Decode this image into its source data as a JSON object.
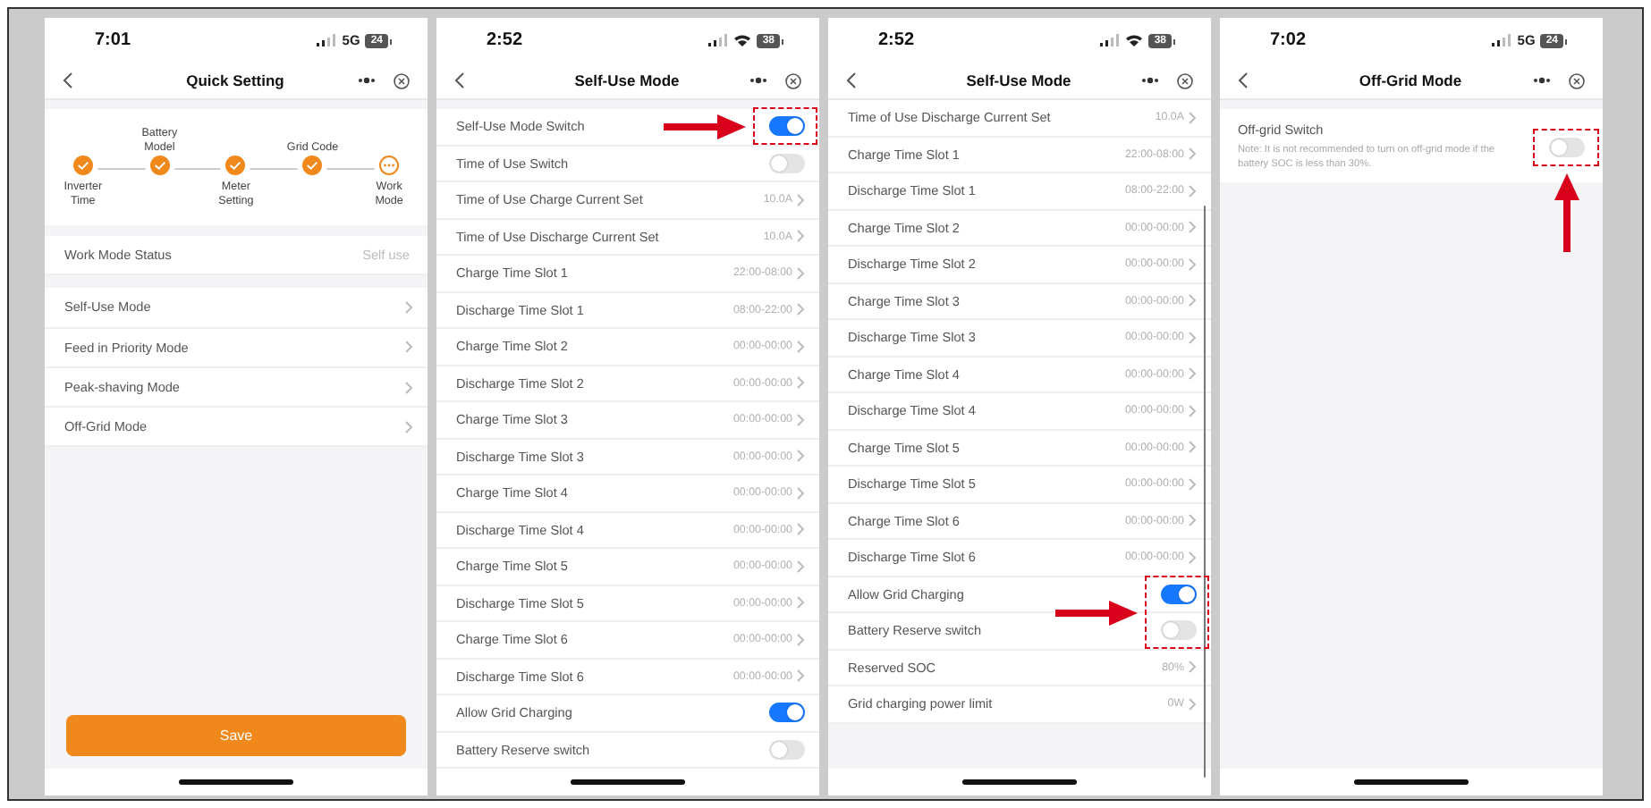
{
  "screens": [
    {
      "kind": "quick_setting",
      "scroll_indicator": false,
      "status_bar": {
        "time": "7:01",
        "network": {
          "kind": "cellular",
          "label": "5G"
        },
        "battery": "24"
      },
      "title": "Quick Setting",
      "steps": [
        {
          "label": "Inverter Time",
          "completed": true
        },
        {
          "label": "Battery Model",
          "completed": true
        },
        {
          "label": "Meter Setting",
          "completed": true
        },
        {
          "label": "Grid Code",
          "completed": true
        },
        {
          "label": "Work Mode",
          "completed": false
        }
      ],
      "groups": [
        [
          {
            "kind": "info",
            "label": "Work Mode Status",
            "value": "Self use"
          }
        ],
        [
          {
            "kind": "link",
            "label": "Self-Use Mode"
          },
          {
            "kind": "link",
            "label": "Feed in Priority Mode"
          },
          {
            "kind": "link",
            "label": "Peak-shaving Mode"
          },
          {
            "kind": "link",
            "label": "Off-Grid Mode"
          }
        ]
      ],
      "save_button": "Save"
    },
    {
      "kind": "settings",
      "scroll_indicator": false,
      "callout": {
        "kind": "left"
      },
      "status_bar": {
        "time": "2:52",
        "network": {
          "kind": "wifi"
        },
        "battery": "38"
      },
      "title": "Self-Use Mode",
      "groups": [
        [
          {
            "kind": "toggle",
            "label": "Self-Use Mode Switch",
            "on": true,
            "highlighted": true
          },
          {
            "kind": "toggle",
            "label": "Time of Use Switch",
            "on": false,
            "highlighted": false
          },
          {
            "kind": "link",
            "label": "Time of Use Charge Current Set",
            "value": "10.0A"
          },
          {
            "kind": "link",
            "label": "Time of Use Discharge Current Set",
            "value": "10.0A"
          },
          {
            "kind": "link",
            "label": "Charge Time Slot 1",
            "value": "22:00-08:00"
          },
          {
            "kind": "link",
            "label": "Discharge Time Slot 1",
            "value": "08:00-22:00"
          },
          {
            "kind": "link",
            "label": "Charge Time Slot 2",
            "value": "00:00-00:00"
          },
          {
            "kind": "link",
            "label": "Discharge Time Slot 2",
            "value": "00:00-00:00"
          },
          {
            "kind": "link",
            "label": "Charge Time Slot 3",
            "value": "00:00-00:00"
          },
          {
            "kind": "link",
            "label": "Discharge Time Slot 3",
            "value": "00:00-00:00"
          },
          {
            "kind": "link",
            "label": "Charge Time Slot 4",
            "value": "00:00-00:00"
          },
          {
            "kind": "link",
            "label": "Discharge Time Slot 4",
            "value": "00:00-00:00"
          },
          {
            "kind": "link",
            "label": "Charge Time Slot 5",
            "value": "00:00-00:00"
          },
          {
            "kind": "link",
            "label": "Discharge Time Slot 5",
            "value": "00:00-00:00"
          },
          {
            "kind": "link",
            "label": "Charge Time Slot 6",
            "value": "00:00-00:00"
          },
          {
            "kind": "link",
            "label": "Discharge Time Slot 6",
            "value": "00:00-00:00"
          },
          {
            "kind": "toggle",
            "label": "Allow Grid Charging",
            "on": true,
            "highlighted": false
          },
          {
            "kind": "toggle",
            "label": "Battery Reserve switch",
            "on": false,
            "highlighted": false
          }
        ]
      ]
    },
    {
      "kind": "settings",
      "scroll_indicator": true,
      "callout": {
        "kind": "left"
      },
      "status_bar": {
        "time": "2:52",
        "network": {
          "kind": "wifi"
        },
        "battery": "38"
      },
      "title": "Self-Use Mode",
      "groups": [
        [
          {
            "kind": "link",
            "label": "Time of Use Discharge Current Set",
            "value": "10.0A"
          },
          {
            "kind": "link",
            "label": "Charge Time Slot 1",
            "value": "22:00-08:00"
          },
          {
            "kind": "link",
            "label": "Discharge Time Slot 1",
            "value": "08:00-22:00"
          },
          {
            "kind": "link",
            "label": "Charge Time Slot 2",
            "value": "00:00-00:00"
          },
          {
            "kind": "link",
            "label": "Discharge Time Slot 2",
            "value": "00:00-00:00"
          },
          {
            "kind": "link",
            "label": "Charge Time Slot 3",
            "value": "00:00-00:00"
          },
          {
            "kind": "link",
            "label": "Discharge Time Slot 3",
            "value": "00:00-00:00"
          },
          {
            "kind": "link",
            "label": "Charge Time Slot 4",
            "value": "00:00-00:00"
          },
          {
            "kind": "link",
            "label": "Discharge Time Slot 4",
            "value": "00:00-00:00"
          },
          {
            "kind": "link",
            "label": "Charge Time Slot 5",
            "value": "00:00-00:00"
          },
          {
            "kind": "link",
            "label": "Discharge Time Slot 5",
            "value": "00:00-00:00"
          },
          {
            "kind": "link",
            "label": "Charge Time Slot 6",
            "value": "00:00-00:00"
          },
          {
            "kind": "link",
            "label": "Discharge Time Slot 6",
            "value": "00:00-00:00"
          },
          {
            "kind": "toggle",
            "label": "Allow Grid Charging",
            "on": true,
            "highlighted": true
          },
          {
            "kind": "toggle",
            "label": "Battery Reserve switch",
            "on": false,
            "highlighted": true
          },
          {
            "kind": "link",
            "label": "Reserved SOC",
            "value": "80%"
          },
          {
            "kind": "link",
            "label": "Grid charging power limit",
            "value": "0W"
          }
        ]
      ]
    },
    {
      "kind": "settings",
      "scroll_indicator": false,
      "callout": {
        "kind": "up"
      },
      "status_bar": {
        "time": "7:02",
        "network": {
          "kind": "cellular",
          "label": "5G"
        },
        "battery": "24"
      },
      "title": "Off-Grid Mode",
      "groups": [
        [
          {
            "kind": "toggle_note",
            "label": "Off-grid Switch",
            "note": "Note: It is not recommended to turn on off-grid mode if the battery SOC is less than 30%.",
            "on": false,
            "highlighted": true
          }
        ]
      ]
    }
  ]
}
